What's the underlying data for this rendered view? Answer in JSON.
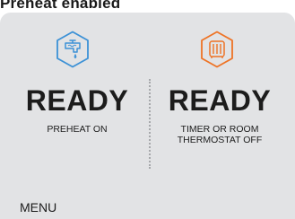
{
  "header": {
    "title": "Preheat enabled"
  },
  "left_panel": {
    "icon": "tap-icon",
    "icon_color": "#3c91d6",
    "status": "READY",
    "subtitle": "PREHEAT ON"
  },
  "right_panel": {
    "icon": "radiator-icon",
    "icon_color": "#ee7325",
    "status": "READY",
    "subtitle_line1": "TIMER OR ROOM",
    "subtitle_line2": "THERMOSTAT OFF"
  },
  "footer": {
    "menu_label": "MENU"
  },
  "colors": {
    "screen_bg": "#e2e3e5",
    "text": "#1c1c1c",
    "divider": "#a6a8ab"
  }
}
